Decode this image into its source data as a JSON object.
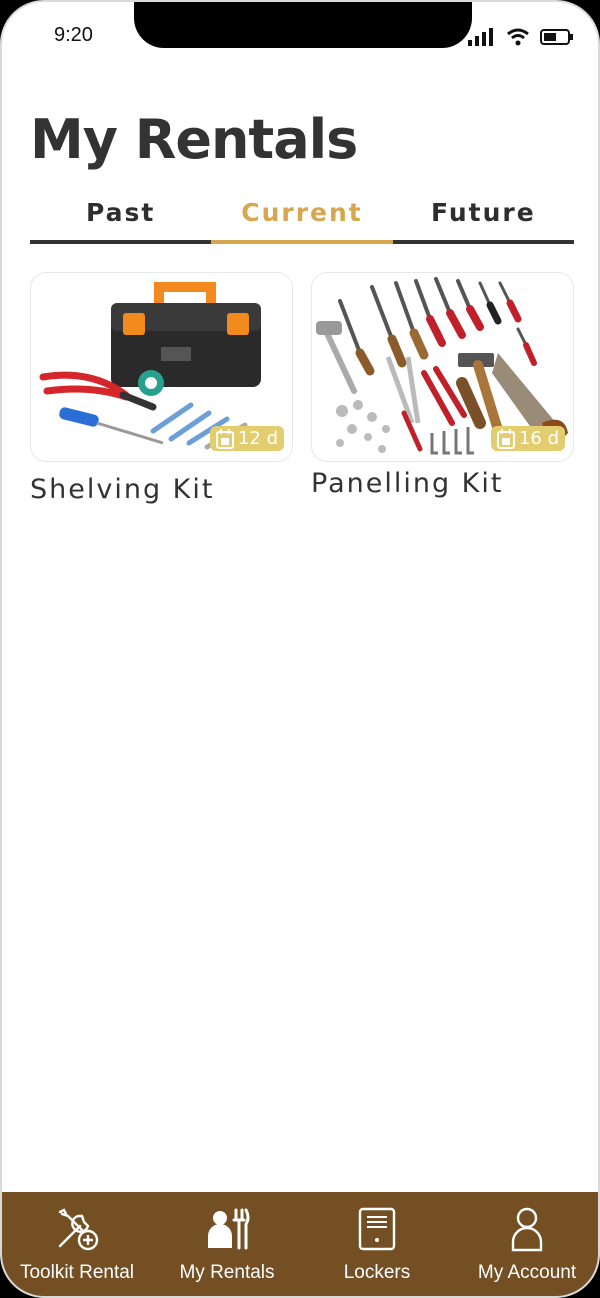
{
  "status_bar": {
    "time": "9:20"
  },
  "page_title": "My Rentals",
  "tabs": [
    {
      "label": "Past"
    },
    {
      "label": "Current",
      "active": true
    },
    {
      "label": "Future"
    }
  ],
  "rentals": [
    {
      "name": "Shelving Kit",
      "days": "12 d",
      "image_icon": "toolbox-image"
    },
    {
      "name": "Panelling Kit",
      "days": "16 d",
      "image_icon": "tool-set-image"
    }
  ],
  "bottom_nav": [
    {
      "label": "Toolkit Rental",
      "icon": "tools-add-icon"
    },
    {
      "label": "My Rentals",
      "icon": "worker-tools-icon"
    },
    {
      "label": "Lockers",
      "icon": "locker-icon"
    },
    {
      "label": "My Account",
      "icon": "person-icon"
    }
  ],
  "colors": {
    "accent": "#d6a650",
    "nav_bg": "#734f23",
    "badge": "#e3cd6e",
    "text": "#333333"
  }
}
